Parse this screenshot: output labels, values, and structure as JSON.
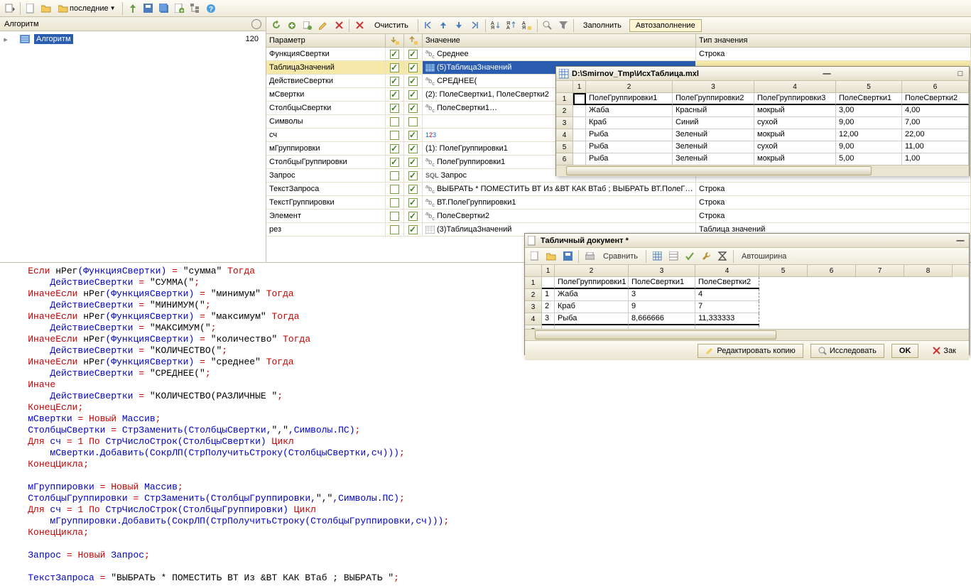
{
  "main_toolbar": {
    "recent_label": "последние"
  },
  "left": {
    "header": "Алгоритм",
    "tree_item": "Алгоритм",
    "tree_count": "120"
  },
  "param_toolbar": {
    "clear": "Очистить",
    "fill": "Заполнить",
    "autofill": "Автозаполнение"
  },
  "param_headers": {
    "param": "Параметр",
    "value": "Значение",
    "type": "Тип значения"
  },
  "params": [
    {
      "name": "ФункцияСвертки",
      "c1": true,
      "c2": true,
      "icon": "abc",
      "val": "Среднее",
      "type": "Строка"
    },
    {
      "name": "ТаблицаЗначений",
      "c1": true,
      "c2": true,
      "icon": "tbl",
      "val": "(5)ТаблицаЗначений",
      "type": "",
      "sel": true
    },
    {
      "name": "ДействиеСвертки",
      "c1": true,
      "c2": true,
      "icon": "abc",
      "val": "СРЕДНЕЕ(",
      "type": ""
    },
    {
      "name": "мСвертки",
      "c1": true,
      "c2": true,
      "icon": "",
      "val": "(2): ПолеСвертки1, ПолеСвертки2",
      "type": ""
    },
    {
      "name": "СтолбцыСвертки",
      "c1": true,
      "c2": true,
      "icon": "abc",
      "val": "ПолеСвертки1…",
      "type": ""
    },
    {
      "name": "Символы",
      "c1": false,
      "c2": false,
      "icon": "",
      "val": "",
      "type": ""
    },
    {
      "name": "сч",
      "c1": false,
      "c2": true,
      "icon": "num",
      "val": "",
      "type": ""
    },
    {
      "name": "мГруппировки",
      "c1": true,
      "c2": true,
      "icon": "",
      "val": "(1): ПолеГруппировки1",
      "type": ""
    },
    {
      "name": "СтолбцыГруппировки",
      "c1": true,
      "c2": true,
      "icon": "abc",
      "val": "ПолеГруппировки1",
      "type": ""
    },
    {
      "name": "Запрос",
      "c1": false,
      "c2": true,
      "icon": "sql",
      "val": "Запрос",
      "type": ""
    },
    {
      "name": "ТекстЗапроса",
      "c1": false,
      "c2": true,
      "icon": "abc",
      "val": "ВЫБРАТЬ * ПОМЕСТИТЬ ВТ Из &ВТ КАК ВТаб ; ВЫБРАТЬ ВТ.ПолеГ…",
      "type": "Строка"
    },
    {
      "name": "ТекстГруппировки",
      "c1": false,
      "c2": true,
      "icon": "abc",
      "val": "ВТ.ПолеГруппировки1",
      "type": "Строка"
    },
    {
      "name": "Элемент",
      "c1": false,
      "c2": true,
      "icon": "abc",
      "val": "ПолеСвертки2",
      "type": "Строка"
    },
    {
      "name": "рез",
      "c1": false,
      "c2": true,
      "icon": "tbl2",
      "val": "(3)ТаблицаЗначений",
      "type": "Таблица значений"
    }
  ],
  "win1": {
    "title": "D:\\Smirnov_Tmp\\ИсхТаблица.mxl",
    "cols": [
      "",
      "1",
      "2",
      "3",
      "4",
      "5",
      "6"
    ],
    "hrow": [
      "",
      "ПолеГруппировки1",
      "ПолеГруппировки2",
      "ПолеГруппировки3",
      "ПолеСвертки1",
      "ПолеСвертки2"
    ],
    "rows": [
      [
        "",
        "Жаба",
        "Красный",
        "мокрый",
        "3,00",
        "4,00"
      ],
      [
        "",
        "Краб",
        "Синий",
        "сухой",
        "9,00",
        "7,00"
      ],
      [
        "",
        "Рыба",
        "Зеленый",
        "мокрый",
        "12,00",
        "22,00"
      ],
      [
        "",
        "Рыба",
        "Зеленый",
        "сухой",
        "9,00",
        "11,00"
      ],
      [
        "",
        "Рыба",
        "Зеленый",
        "мокрый",
        "5,00",
        "1,00"
      ]
    ]
  },
  "win2": {
    "title": "Табличный документ *",
    "compare": "Сравнить",
    "autowidth": "Автоширина",
    "cols": [
      "",
      "1",
      "2",
      "3",
      "4",
      "5",
      "6",
      "7",
      "8"
    ],
    "hrow": [
      "",
      "ПолеГруппировки1",
      "ПолеСвертки1",
      "ПолеСвертки2"
    ],
    "rows": [
      [
        "1",
        "Жаба",
        "3",
        "4"
      ],
      [
        "2",
        "Краб",
        "9",
        "7"
      ],
      [
        "3",
        "Рыба",
        "8,666666",
        "11,333333"
      ]
    ],
    "edit_copy": "Редактировать копию",
    "explore": "Исследовать",
    "ok": "OK",
    "close": "Зак"
  },
  "code": {
    "l1a": "Если",
    "l1b": " нРег",
    "l1c": "(ФункцияСвертки) ",
    "l1d": "= ",
    "l1e": "\"сумма\"",
    "l1f": " Тогда",
    "l2a": "        ДействиеСвертки ",
    "l2b": "= ",
    "l2c": "\"СУММА(\"",
    "l2d": ";",
    "l3a": "ИначеЕсли",
    "l3b": " нРег",
    "l3c": "(ФункцияСвертки) ",
    "l3d": "= ",
    "l3e": "\"минимум\"",
    "l3f": " Тогда",
    "l4c": "\"МИНИМУМ(\"",
    "l5e": "\"максимум\"",
    "l6c": "\"МАКСИМУМ(\"",
    "l7e": "\"количество\"",
    "l8c": "\"КОЛИЧЕСТВО(\"",
    "l9e": "\"среднее\"",
    "l10c": "\"СРЕДНЕЕ(\"",
    "l11": "Иначе",
    "l12c": "\"КОЛИЧЕСТВО(РАЗЛИЧНЫЕ \"",
    "l13": "КонецЕсли",
    "l14a": "мСвертки ",
    "l14b": "= ",
    "l14c": "Новый",
    "l14d": " Массив",
    "l15a": "СтолбцыСвертки ",
    "l15b": "= ",
    "l15c": "СтрЗаменить",
    "l15d": "(СтолбцыСвертки,",
    "l15e": "\",\"",
    "l15f": ",Символы.ПС)",
    "l16a": "Для",
    "l16b": " сч ",
    "l16c": "= ",
    "l16d": "1",
    "l16e": " По ",
    "l16f": "СтрЧислоСтрок",
    "l16g": "(СтолбцыСвертки) ",
    "l16h": "Цикл",
    "l17a": "        мСвертки.Добавить",
    "l17b": "(",
    "l17c": "СокрЛП",
    "l17d": "(",
    "l17e": "СтрПолучитьСтроку",
    "l17f": "(СтолбцыСвертки,сч)))",
    "l18": "КонецЦикла",
    "l20a": "мГруппировки ",
    "l21a": "СтолбцыГруппировки ",
    "l21d": "(СтолбцыГруппировки,",
    "l22g": "(СтолбцыГруппировки) ",
    "l23a": "        мГруппировки.Добавить",
    "l23f": "(СтолбцыГруппировки,сч)))",
    "l26a": "Запрос ",
    "l26d": " Запрос",
    "l28a": "ТекстЗапроса ",
    "l28c": "\"ВЫБРАТЬ * ПОМЕСТИТЬ ВТ Из &ВТ КАК ВТаб ; ВЫБРАТЬ \""
  }
}
